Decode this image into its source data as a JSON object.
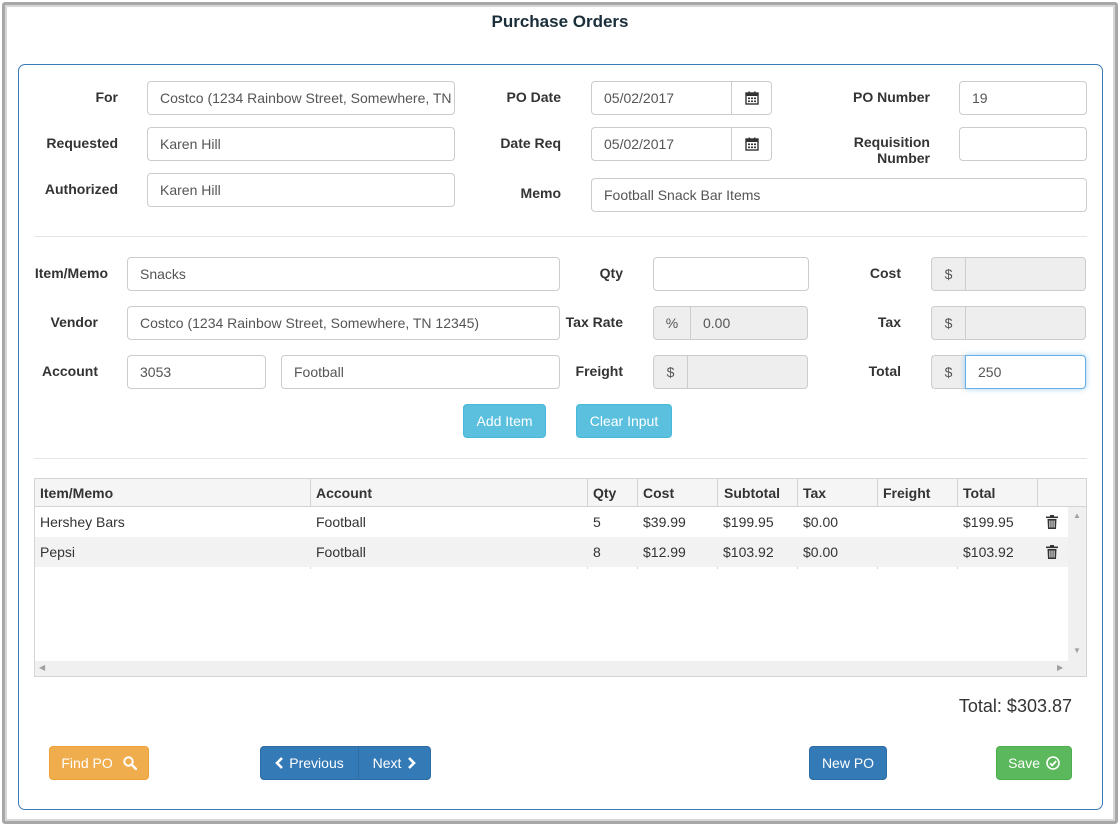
{
  "page": {
    "title": "Purchase Orders"
  },
  "header_form": {
    "for": {
      "label": "For",
      "value": "Costco (1234 Rainbow Street, Somewhere, TN 12345)"
    },
    "requested": {
      "label": "Requested",
      "value": "Karen Hill"
    },
    "authorized": {
      "label": "Authorized",
      "value": "Karen Hill"
    },
    "po_date": {
      "label": "PO Date",
      "value": "05/02/2017"
    },
    "date_req": {
      "label": "Date Req",
      "value": "05/02/2017"
    },
    "memo": {
      "label": "Memo",
      "value": "Football Snack Bar Items"
    },
    "po_number": {
      "label": "PO Number",
      "value": "19"
    },
    "requisition_number": {
      "label_line1": "Requisition",
      "label_line2": "Number",
      "value": ""
    },
    "calendar_icon": "calendar-icon"
  },
  "item_form": {
    "item_memo": {
      "label": "Item/Memo",
      "value": "Snacks"
    },
    "vendor": {
      "label": "Vendor",
      "value": "Costco (1234 Rainbow Street, Somewhere, TN 12345)"
    },
    "account": {
      "label": "Account",
      "number": "3053",
      "name": "Football"
    },
    "qty": {
      "label": "Qty",
      "value": ""
    },
    "tax_rate": {
      "label": "Tax Rate",
      "addon": "%",
      "value": "0.00"
    },
    "freight": {
      "label": "Freight",
      "addon": "$",
      "value": ""
    },
    "cost": {
      "label": "Cost",
      "addon": "$",
      "value": ""
    },
    "tax": {
      "label": "Tax",
      "addon": "$",
      "value": ""
    },
    "total": {
      "label": "Total",
      "addon": "$",
      "value": "250"
    },
    "add_item_label": "Add Item",
    "clear_input_label": "Clear Input"
  },
  "items_table": {
    "columns": [
      "Item/Memo",
      "Account",
      "Qty",
      "Cost",
      "Subtotal",
      "Tax",
      "Freight",
      "Total"
    ],
    "rows": [
      {
        "item": "Hershey Bars",
        "account": "Football",
        "qty": "5",
        "cost": "$39.99",
        "subtotal": "$199.95",
        "tax": "$0.00",
        "freight": "",
        "total": "$199.95"
      },
      {
        "item": "Pepsi",
        "account": "Football",
        "qty": "8",
        "cost": "$12.99",
        "subtotal": "$103.92",
        "tax": "$0.00",
        "freight": "",
        "total": "$103.92"
      }
    ],
    "row_action_icon": "trash-icon"
  },
  "grand_total": "Total: $303.87",
  "footer": {
    "find_po_label": "Find PO",
    "previous_label": "Previous",
    "next_label": "Next",
    "new_po_label": "New PO",
    "save_label": "Save"
  },
  "colors": {
    "panel_border": "#3a7ab8",
    "info": "#5bc0de",
    "warning": "#f0ad4e",
    "primary": "#337ab7",
    "success": "#5cb85c"
  }
}
